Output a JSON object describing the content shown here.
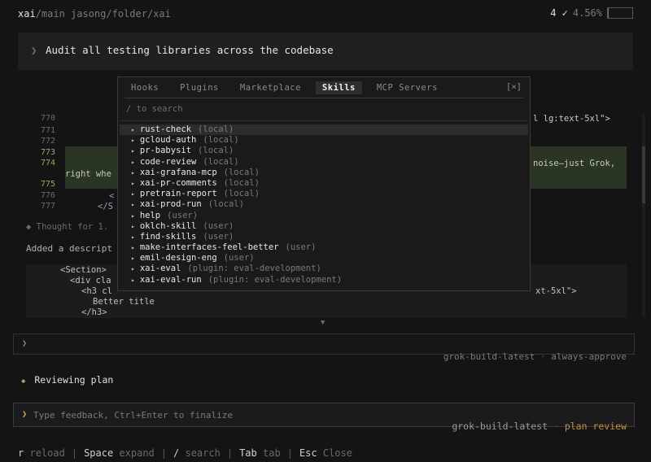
{
  "header": {
    "branch": "xai",
    "branch_sep": "/main",
    "path": " jasong/folder/xai",
    "count": "4 ✓",
    "percent": "4.56%",
    "context_fraction": 0.0456
  },
  "prompt": {
    "chevron": "❯",
    "text": "Audit all testing libraries across the codebase"
  },
  "background": {
    "line_numbers": [
      "770",
      "771",
      "772",
      "773",
      "774",
      "775",
      "776",
      "777"
    ],
    "code_right_770": "l lg:text-5xl\">",
    "code_right_774": "noise—just Grok,",
    "code_left_774b": "right whe",
    "code_776": "<",
    "code_777": "</S",
    "thought": "◆ Thought for 1.",
    "added": "Added a descript",
    "diff_lines": [
      "<Section>",
      "<div cla",
      "<h3 cl",
      "Better title",
      "</h3>"
    ],
    "diff_right": "xt-5xl\">",
    "collapse_arrow": "▼"
  },
  "input_box": {
    "chevron": "❯"
  },
  "status1": {
    "model": "grok-build-latest",
    "sep": "·",
    "mode": "always-approve"
  },
  "reviewing": {
    "icon": "◆",
    "text": "Reviewing plan"
  },
  "feedback": {
    "chevron": "❯",
    "placeholder": "Type feedback, Ctrl+Enter to finalize"
  },
  "status2": {
    "model": "grok-build-latest",
    "sep": "·",
    "mode": "plan review"
  },
  "footer": [
    {
      "key": "r",
      "label": "reload"
    },
    {
      "key": "Space",
      "label": "expand"
    },
    {
      "key": "/",
      "label": "search"
    },
    {
      "key": "Tab",
      "label": "tab"
    },
    {
      "key": "Esc",
      "label": "Close"
    }
  ],
  "footer_sep": "|",
  "modal": {
    "tabs": [
      "Hooks",
      "Plugins",
      "Marketplace",
      "Skills",
      "MCP Servers"
    ],
    "active_tab": "Skills",
    "close": "[×]",
    "search_placeholder": "/ to search",
    "selected_index": 0,
    "skills": [
      {
        "name": "rust-check",
        "scope": "(local)"
      },
      {
        "name": "gcloud-auth",
        "scope": "(local)"
      },
      {
        "name": "pr-babysit",
        "scope": "(local)"
      },
      {
        "name": "code-review",
        "scope": "(local)"
      },
      {
        "name": "xai-grafana-mcp",
        "scope": "(local)"
      },
      {
        "name": "xai-pr-comments",
        "scope": "(local)"
      },
      {
        "name": "pretrain-report",
        "scope": "(local)"
      },
      {
        "name": "xai-prod-run",
        "scope": "(local)"
      },
      {
        "name": "help",
        "scope": "(user)"
      },
      {
        "name": "oklch-skill",
        "scope": "(user)"
      },
      {
        "name": "find-skills",
        "scope": "(user)"
      },
      {
        "name": "make-interfaces-feel-better",
        "scope": "(user)"
      },
      {
        "name": "emil-design-eng",
        "scope": "(user)"
      },
      {
        "name": "xai-eval",
        "scope": "(plugin: eval-development)"
      },
      {
        "name": "xai-eval-run",
        "scope": "(plugin: eval-development)"
      }
    ],
    "bullet": "▸"
  },
  "colors": {
    "accent_yellow": "#e0b040",
    "highlight_green": "#2a3621",
    "status_orange": "#c8903a"
  }
}
